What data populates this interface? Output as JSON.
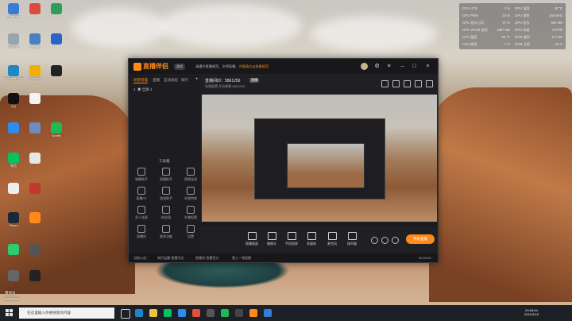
{
  "desktop": {
    "icons": [
      {
        "label": "Cleaner",
        "color": "#3a7bd5"
      },
      {
        "label": "",
        "color": "#d94c3a"
      },
      {
        "label": "",
        "color": "#2e9e5a"
      },
      {
        "label": "回收站",
        "color": "#9aa4ad"
      },
      {
        "label": "Plexar",
        "color": "#4a7fc0"
      },
      {
        "label": "",
        "color": "#2b63c8"
      },
      {
        "label": "Microsoft Edge",
        "color": "#1e88c7"
      },
      {
        "label": "Rockstar",
        "color": "#f0b000"
      },
      {
        "label": "",
        "color": "#222"
      },
      {
        "label": "QQ",
        "color": "#111"
      },
      {
        "label": "",
        "color": "#f3f3f3"
      },
      {
        "label": "",
        "color": "#2d8cf0"
      },
      {
        "label": "",
        "color": "#6c8ebf"
      },
      {
        "label": "Spotify",
        "color": "#1db954"
      },
      {
        "label": "微信",
        "color": "#07c160"
      },
      {
        "label": "",
        "color": "#e6e6e6"
      },
      {
        "label": "",
        "color": "#eee"
      },
      {
        "label": "",
        "color": "#c0392b"
      },
      {
        "label": "Steam",
        "color": "#1b2838"
      },
      {
        "label": "",
        "color": "#ff8a1a"
      },
      {
        "label": "",
        "color": "#2ecc71"
      },
      {
        "label": "",
        "color": "#555"
      },
      {
        "label": "",
        "color": "#666"
      },
      {
        "label": "",
        "color": "#222"
      }
    ],
    "bottom_labels": [
      "傅周号",
      "5861256"
    ]
  },
  "stats": [
    {
      "k1": "GPU UTIL",
      "v1": "3 %",
      "k2": "GPU 温度",
      "v2": "48 ℃"
    },
    {
      "k1": "GPU PWR",
      "v1": "26 W",
      "k2": "GPU 频率",
      "v2": "255 MHz"
    },
    {
      "k1": "GPU 显存占用",
      "v1": "87 %",
      "k2": "GPU 显存",
      "v2": "504 MB"
    },
    {
      "k1": "GPU VRAM 使用",
      "v1": "1887 MB",
      "k2": "GPU 风扇",
      "v2": "0 RPM"
    },
    {
      "k1": "CPU 温度",
      "v1": "60 ℃",
      "k2": "RAM 使用",
      "v2": "6.2 GB"
    },
    {
      "k1": "CPU 使用",
      "v1": "7 %",
      "k2": "RAM 占用",
      "v2": "42 %"
    }
  ],
  "app": {
    "logo_text": "直播伴侣",
    "version": "测试",
    "notice_prefix": "请遵守直播规范，文明直播，",
    "notice_link": "详情请点击查看规范",
    "tabs": [
      "场景管理",
      "直播",
      "互动发起",
      "排行"
    ],
    "scene_count": "1",
    "scene_label": "全屏 1",
    "toolbox_title": "工具箱",
    "tools": [
      {
        "label": "弹幕助手"
      },
      {
        "label": "直播助手"
      },
      {
        "label": "视频连线"
      },
      {
        "label": "直播PK"
      },
      {
        "label": "游戏助手"
      },
      {
        "label": "礼物特效"
      },
      {
        "label": "多人连麦"
      },
      {
        "label": "粉丝团"
      },
      {
        "label": "礼物投票"
      },
      {
        "label": "直播间"
      },
      {
        "label": "更多功能"
      },
      {
        "label": "设置"
      }
    ],
    "room_title": "直播间ID：5861256",
    "room_tag": "直播",
    "room_sub": "场景配置    开启弹幕   5861256",
    "like_count": "0",
    "controls": [
      {
        "label": "直播画面"
      },
      {
        "label": "摄像头"
      },
      {
        "label": "手机投屏"
      },
      {
        "label": "多媒体"
      },
      {
        "label": "麦克风"
      },
      {
        "label": "扬声器"
      }
    ],
    "golive_label": "开始直播",
    "status": {
      "left": "当前公告：",
      "mid1": "知识宝藏·直播可达",
      "mid2": "直播间·直播官方",
      "mid3": "第上一场直播",
      "time": "00:00:00"
    }
  },
  "taskbar": {
    "search_placeholder": "在这里输入你要搜索的内容",
    "time": "20:55:54",
    "date": "2021/3/15"
  }
}
